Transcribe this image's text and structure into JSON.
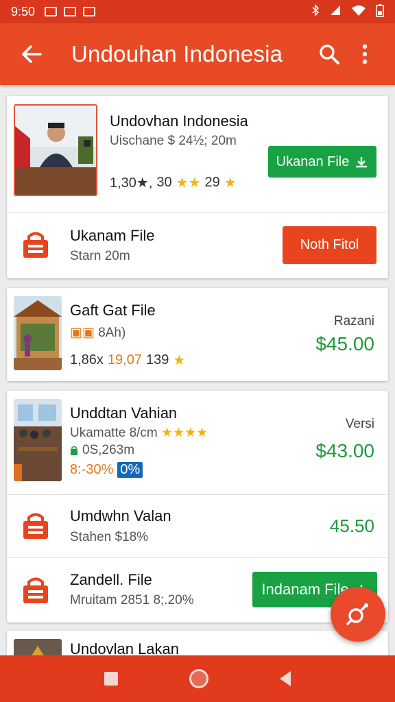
{
  "status_bar": {
    "time": "9:50"
  },
  "app_bar": {
    "title": "Undouhan Indonesia"
  },
  "colors": {
    "primary": "#e84a26",
    "green": "#18a243",
    "star": "#f3b311",
    "price": "#1f9a3b"
  },
  "items": [
    {
      "title": "Undovhan Indonesia",
      "subtitle": "Uischane $ 24½; 20m",
      "meta_a": "1,30★,",
      "meta_b": "30",
      "meta_c": "29",
      "button": "Ukanan File"
    },
    {
      "title": "Ukanam File",
      "subtitle": "Starn 20m",
      "button": "Noth Fitol"
    },
    {
      "title": "Gaft Gat File",
      "subtitle": "8Ah)",
      "meta_a": "1,86x",
      "meta_b": "19,07",
      "meta_c": "139",
      "label": "Razani",
      "price": "$45.00"
    },
    {
      "title": "Unddtan Vahian",
      "subtitle": "Ukamatte 8/cm",
      "size": "0S,263m",
      "percent": "8:-30%",
      "badge": "0%",
      "label": "Versi",
      "price": "$43.00"
    },
    {
      "title": "Umdwhn Valan",
      "subtitle": "Stahen $18%",
      "price": "45.50"
    },
    {
      "title": "Zandell. File",
      "subtitle": "Mruitam 2851 8;.20%",
      "button": "Indanam File"
    },
    {
      "title": "Undovlan Lakan"
    }
  ]
}
